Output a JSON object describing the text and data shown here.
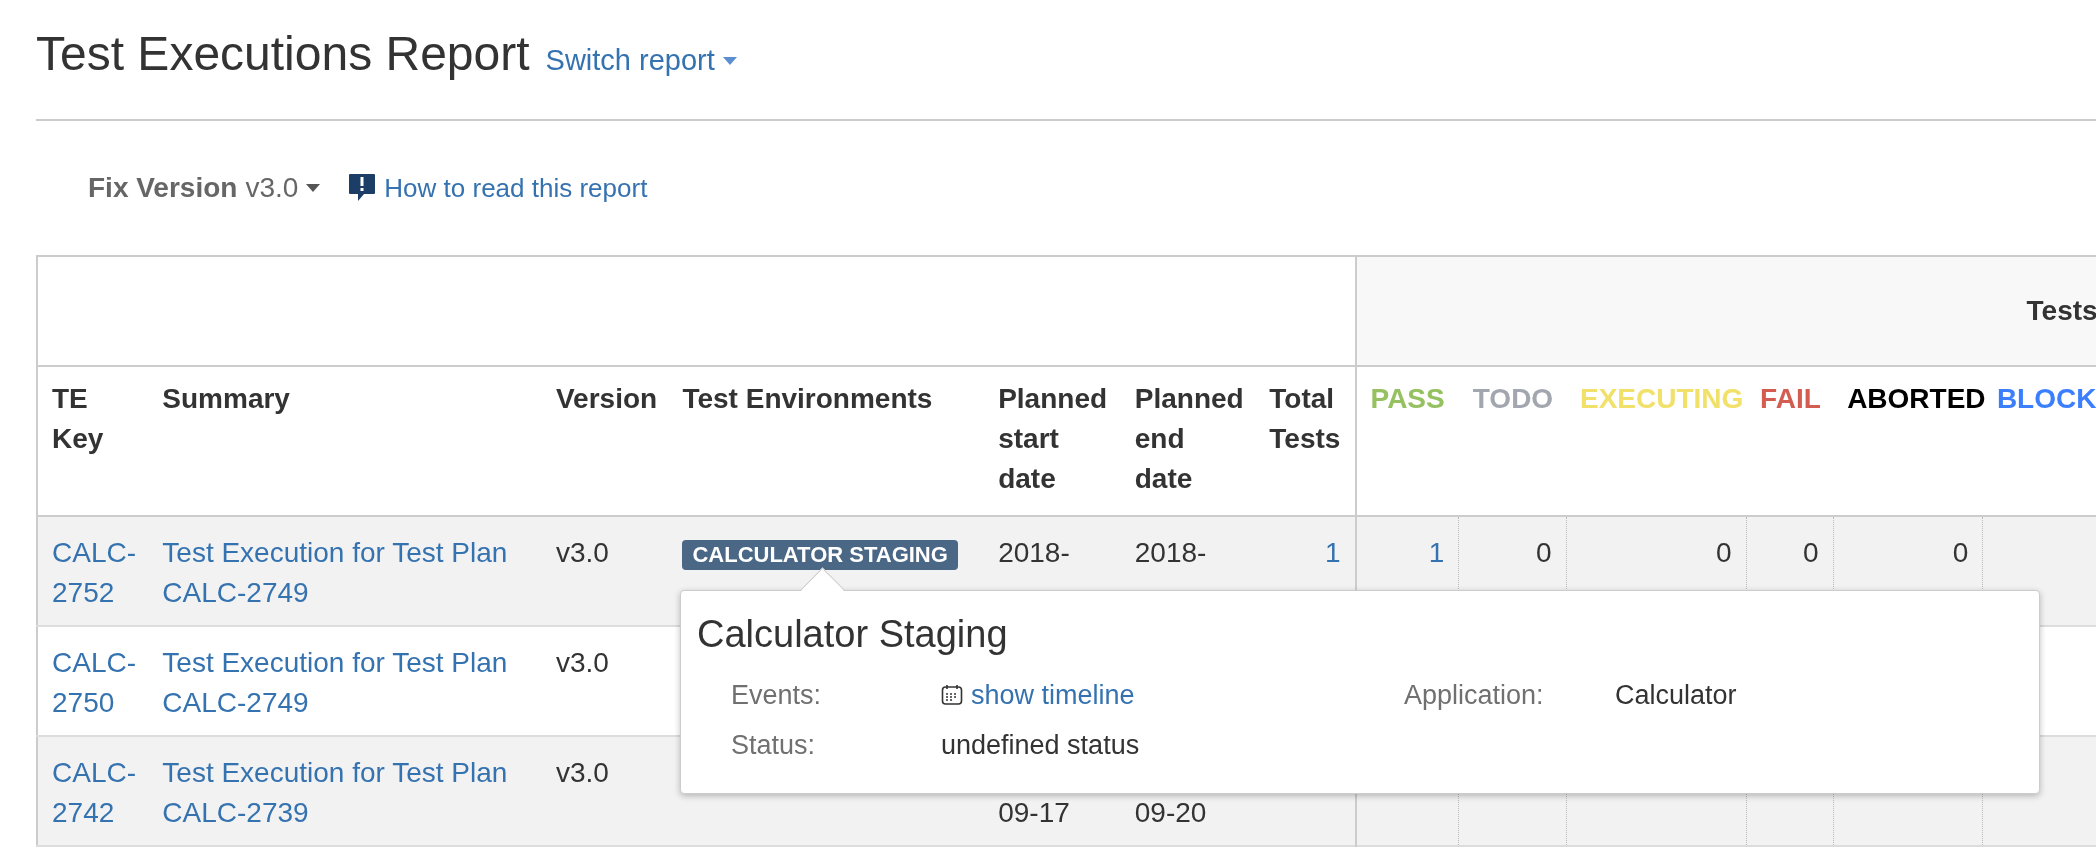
{
  "header": {
    "title": "Test Executions Report",
    "switch_link": "Switch report"
  },
  "toolbar": {
    "filter_label": "Fix Version",
    "filter_value": "v3.0",
    "help_link": "How to read this report"
  },
  "table": {
    "group_header": "Tests",
    "columns": [
      "TE Key",
      "Summary",
      "Version",
      "Test Environments",
      "Planned start date",
      "Planned end date",
      "Total Tests"
    ],
    "status_columns": [
      {
        "label": "PASS",
        "color": "#95c160"
      },
      {
        "label": "TODO",
        "color": "#a2a6ae"
      },
      {
        "label": "EXECUTING",
        "color": "#f1e069"
      },
      {
        "label": "FAIL",
        "color": "#d45d52"
      },
      {
        "label": "ABORTED",
        "color": "#000000"
      },
      {
        "label": "BLOCK",
        "color": "#3b7fff"
      }
    ],
    "rows": [
      {
        "key": "CALC-2752",
        "summary": "Test Execution for Test Plan CALC-2749",
        "version": "v3.0",
        "environment": "CALCULATOR STAGING",
        "planned_start": {
          "line1": "2018-"
        },
        "planned_end": {
          "line1": "2018-"
        },
        "total": "1",
        "counts": [
          "1",
          "0",
          "0",
          "0",
          "0"
        ]
      },
      {
        "key": "CALC-2750",
        "summary": "Test Execution for Test Plan CALC-2749",
        "version": "v3.0",
        "planned_start": {},
        "planned_end": {},
        "counts": []
      },
      {
        "key": "CALC-2742",
        "summary": "Test Execution for Test Plan CALC-2739",
        "version": "v3.0",
        "planned_start": {
          "line2": "09-17"
        },
        "planned_end": {
          "line2": "09-20"
        },
        "counts": []
      }
    ]
  },
  "popover": {
    "title": "Calculator Staging",
    "events_label": "Events:",
    "events_link": "show timeline",
    "status_label": "Status:",
    "status_value": "undefined status",
    "application_label": "Application:",
    "application_value": "Calculator"
  }
}
